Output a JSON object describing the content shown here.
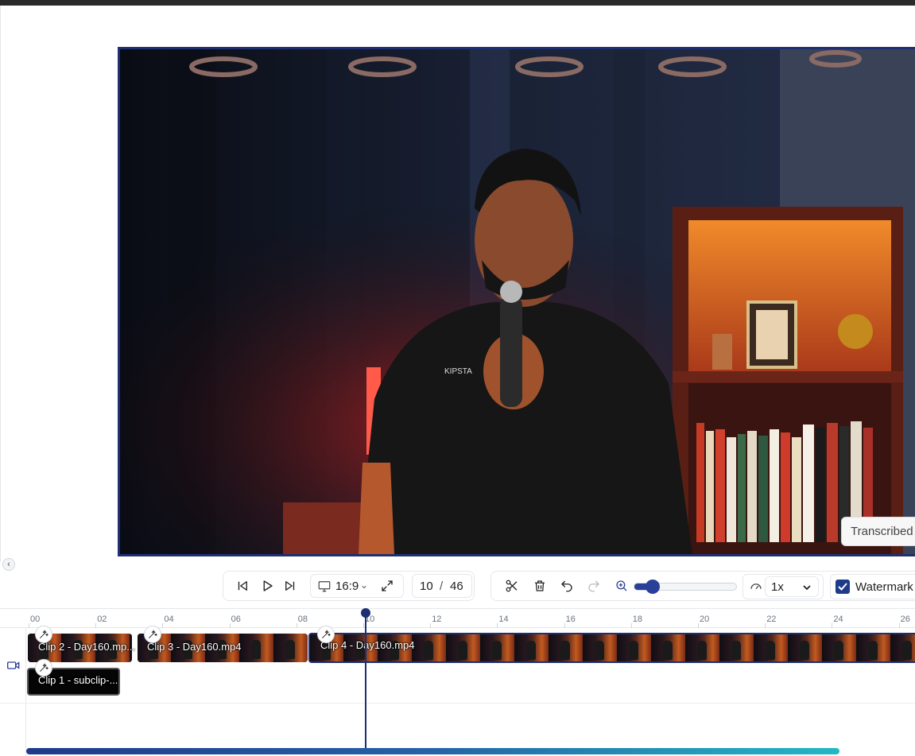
{
  "preview": {
    "overlay_text": "Transcribed"
  },
  "controls": {
    "aspect_ratio": "16:9",
    "current_page": "10",
    "separator": "/",
    "total_pages": "46",
    "speed": "1x",
    "watermark_label": "Watermark",
    "watermark_checked": true,
    "zoom_level_fraction": 0.15
  },
  "timeline": {
    "ticks": [
      "00",
      "02",
      "04",
      "06",
      "08",
      "10",
      "12",
      "14",
      "16",
      "18",
      "20",
      "22",
      "24",
      "26"
    ],
    "clips": [
      {
        "label": "Clip 2 - Day160.mp..."
      },
      {
        "label": "Clip 3 - Day160.mp4"
      },
      {
        "label": "Clip 4 - Day160.mp4"
      },
      {
        "label": "Clip 1 - subclip-..."
      }
    ],
    "playhead_time": 10
  },
  "icons": {
    "skip_back": "skip-back-icon",
    "play": "play-icon",
    "skip_forward": "skip-forward-icon",
    "monitor": "monitor-icon",
    "fullscreen": "fullscreen-icon",
    "cut": "scissors-icon",
    "delete": "trash-icon",
    "undo": "undo-icon",
    "redo": "redo-icon",
    "zoom": "zoom-in-icon",
    "speed": "speedometer-icon",
    "camera": "video-camera-icon",
    "magic": "magic-wand-icon"
  },
  "colors": {
    "accent": "#1e2f73",
    "checkbox": "#1e3a8a"
  }
}
